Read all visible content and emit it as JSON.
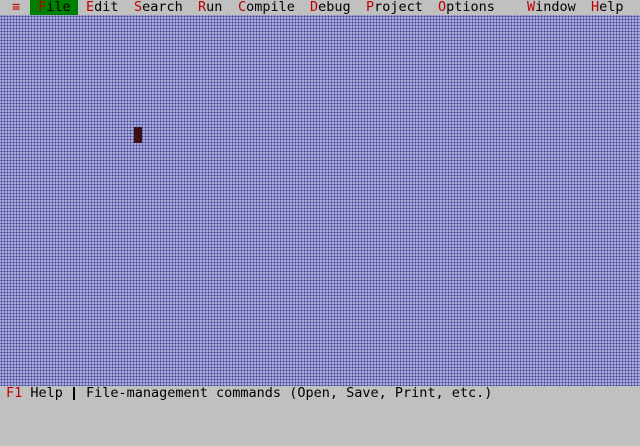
{
  "menubar": {
    "system_icon": "≡",
    "items": [
      {
        "hotkey": "F",
        "rest": "ile"
      },
      {
        "hotkey": "E",
        "rest": "dit"
      },
      {
        "hotkey": "S",
        "rest": "earch"
      },
      {
        "hotkey": "R",
        "rest": "un"
      },
      {
        "hotkey": "C",
        "rest": "ompile"
      },
      {
        "hotkey": "D",
        "rest": "ebug"
      },
      {
        "hotkey": "P",
        "rest": "roject"
      },
      {
        "hotkey": "O",
        "rest": "ptions"
      },
      {
        "hotkey": "W",
        "rest": "indow"
      },
      {
        "hotkey": "H",
        "rest": "elp"
      }
    ],
    "selected": "File"
  },
  "statusbar": {
    "f1_key": "F1",
    "f1_label": " Help",
    "hint": "File-management commands (Open, Save, Print, etc.)"
  },
  "colors": {
    "menu_bg": "#c0c0c0",
    "hotkey": "#c00000",
    "selected_bg": "#008000",
    "desktop": "#b4b8dc"
  }
}
